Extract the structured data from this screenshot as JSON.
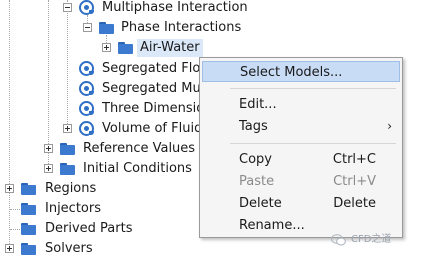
{
  "tree": {
    "items": [
      {
        "label": "Multiphase Interaction",
        "icon": "model-icon",
        "expander": "minus"
      },
      {
        "label": "Phase Interactions",
        "icon": "folder-icon",
        "expander": "minus"
      },
      {
        "label": "Air-Water",
        "icon": "folder-icon",
        "expander": "plus",
        "selected": true
      },
      {
        "label": "Segregated Flow",
        "icon": "model-icon"
      },
      {
        "label": "Segregated Mul",
        "icon": "model-icon"
      },
      {
        "label": "Three Dimension",
        "icon": "model-icon"
      },
      {
        "label": "Volume of Fluid",
        "icon": "model-icon",
        "expander": "plus"
      },
      {
        "label": "Reference Values",
        "icon": "folder-icon",
        "expander": "plus"
      },
      {
        "label": "Initial Conditions",
        "icon": "folder-icon",
        "expander": "plus"
      },
      {
        "label": "Regions",
        "icon": "folder-icon",
        "expander": "plus"
      },
      {
        "label": "Injectors",
        "icon": "folder-icon"
      },
      {
        "label": "Derived Parts",
        "icon": "folder-icon"
      },
      {
        "label": "Solvers",
        "icon": "folder-icon",
        "expander": "plus"
      }
    ]
  },
  "context_menu": {
    "items": [
      {
        "label": "Select Models...",
        "shortcut": "",
        "highlighted": true
      },
      {
        "label": "Edit...",
        "shortcut": ""
      },
      {
        "label": "Tags",
        "shortcut": "",
        "submenu_arrow": "›"
      },
      {
        "label": "Copy",
        "shortcut": "Ctrl+C"
      },
      {
        "label": "Paste",
        "shortcut": "Ctrl+V",
        "disabled": true
      },
      {
        "label": "Delete",
        "shortcut": "Delete"
      },
      {
        "label": "Rename...",
        "shortcut": ""
      }
    ]
  },
  "watermark": {
    "text": "CFD之道",
    "icon": "wechat-icon"
  },
  "colors": {
    "icon_blue": "#2f6fc6",
    "menu_bg": "#f5f5f5",
    "highlight": "#c9dcf5",
    "selected_bg": "#dbe8f8"
  }
}
